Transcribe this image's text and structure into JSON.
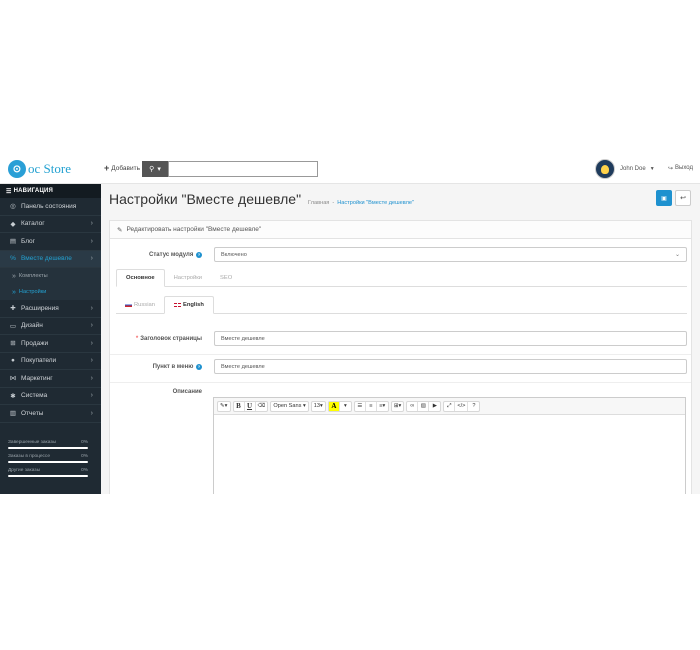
{
  "header": {
    "logo_text": "oc Store",
    "add_label": "Добавить",
    "search_placeholder": "",
    "user_name": "John Doe",
    "logout_label": "Выход"
  },
  "sidebar": {
    "nav_title": "НАВИГАЦИЯ",
    "items": [
      {
        "label": "Панель состояния",
        "icon": "dashboard-icon",
        "glyph": "◎",
        "arrow": false
      },
      {
        "label": "Каталог",
        "icon": "tag-icon",
        "glyph": "◆",
        "arrow": true
      },
      {
        "label": "Блог",
        "icon": "book-icon",
        "glyph": "▤",
        "arrow": true
      },
      {
        "label": "Вместе дешевле",
        "icon": "percent-icon",
        "glyph": "%",
        "arrow": true,
        "active": true
      },
      {
        "label": "Расширения",
        "icon": "puzzle-icon",
        "glyph": "✚",
        "arrow": true
      },
      {
        "label": "Дизайн",
        "icon": "monitor-icon",
        "glyph": "▭",
        "arrow": true
      },
      {
        "label": "Продажи",
        "icon": "cart-icon",
        "glyph": "⊞",
        "arrow": true
      },
      {
        "label": "Покупатели",
        "icon": "user-icon",
        "glyph": "●",
        "arrow": true
      },
      {
        "label": "Маркетинг",
        "icon": "share-icon",
        "glyph": "⋈",
        "arrow": true
      },
      {
        "label": "Система",
        "icon": "gear-icon",
        "glyph": "✱",
        "arrow": true
      },
      {
        "label": "Отчеты",
        "icon": "chart-icon",
        "glyph": "▥",
        "arrow": true
      }
    ],
    "sub_items": [
      {
        "label": "Комплекты"
      },
      {
        "label": "Настройки",
        "active": true
      }
    ],
    "stats": [
      {
        "label": "Завершенные заказы",
        "value": "0%"
      },
      {
        "label": "Заказы в процессе",
        "value": "0%"
      },
      {
        "label": "Другие заказы",
        "value": "0%"
      }
    ]
  },
  "page": {
    "title": "Настройки \"Вместе дешевле\"",
    "breadcrumb_home": "Главная",
    "breadcrumb_sep": "-",
    "breadcrumb_current": "Настройки \"Вместе дешевле\""
  },
  "panel": {
    "heading": "Редактировать настройки \"Вместе дешевле\"",
    "status_label": "Статус модуля",
    "status_value": "Включено",
    "tabs": [
      "Основное",
      "Настройки",
      "SEO"
    ],
    "lang_tabs": [
      "Russian",
      "English"
    ],
    "page_title_label": "Заголовок страницы",
    "page_title_value": "Вместе дешевле",
    "menu_item_label": "Пункт в меню",
    "menu_item_value": "Вместе дешевле",
    "description_label": "Описание"
  },
  "editor": {
    "font_name": "Open Sans",
    "font_size": "13"
  },
  "colors": {
    "accent": "#1e91cf",
    "sidebar_bg": "#1f2a33",
    "active_link": "#23a1d1"
  }
}
